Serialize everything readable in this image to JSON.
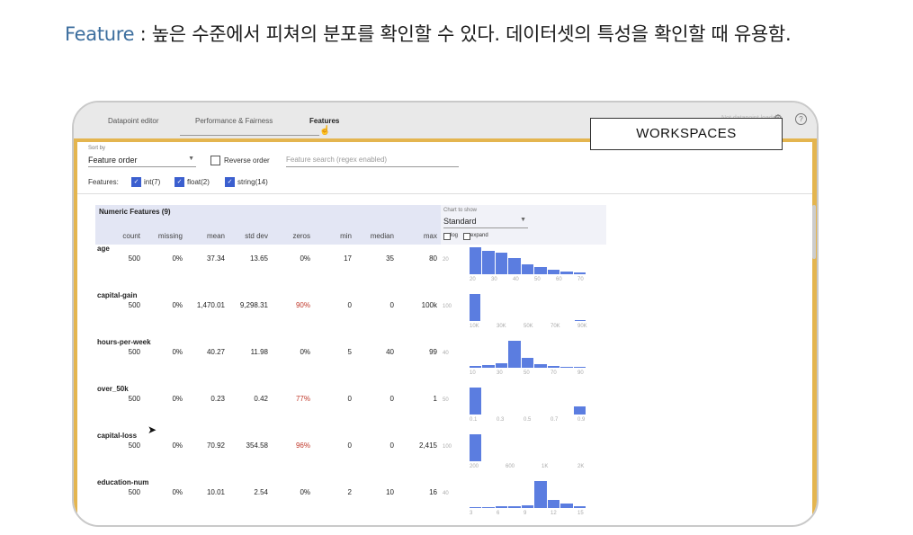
{
  "heading": {
    "keyword": "Feature",
    "text": " : 높은 수준에서 피쳐의 분포를 확인할 수 있다. 데이터셋의 특성을 확인할 때 유용함."
  },
  "header": {
    "tabs": [
      "Datapoint editor",
      "Performance & Fairness",
      "Features"
    ],
    "active_tab": "Features",
    "right_text": "Not datapoint loaded",
    "workspaces_label": "WORKSPACES"
  },
  "controls": {
    "sort_by_label": "Sort by",
    "sort_by_value": "Feature order",
    "reverse_order_label": "Reverse order",
    "search_placeholder": "Feature search (regex enabled)",
    "features_label": "Features:",
    "feature_filters": [
      {
        "label": "int(7)",
        "checked": true
      },
      {
        "label": "float(2)",
        "checked": true
      },
      {
        "label": "string(14)",
        "checked": true
      }
    ]
  },
  "table": {
    "title": "Numeric Features (9)",
    "columns": [
      "count",
      "missing",
      "mean",
      "std dev",
      "zeros",
      "min",
      "median",
      "max"
    ],
    "chart_to_show_label": "Chart to show",
    "chart_to_show_value": "Standard",
    "log_label": "log",
    "expand_label": "expand",
    "rows": [
      {
        "name": "age",
        "count": "500",
        "missing": "0%",
        "mean": "37.34",
        "std": "13.65",
        "zeros": "0%",
        "zeros_red": false,
        "min": "17",
        "median": "35",
        "max": "80",
        "axis_label": "20",
        "ticks": [
          "20",
          "30",
          "40",
          "50",
          "60",
          "70"
        ],
        "hist": [
          1.0,
          0.85,
          0.8,
          0.6,
          0.35,
          0.25,
          0.15,
          0.1,
          0.05
        ]
      },
      {
        "name": "capital-gain",
        "count": "500",
        "missing": "0%",
        "mean": "1,470.01",
        "std": "9,298.31",
        "zeros": "90%",
        "zeros_red": true,
        "min": "0",
        "median": "0",
        "max": "100k",
        "axis_label": "100",
        "ticks": [
          "10K",
          "30K",
          "50K",
          "70K",
          "90K"
        ],
        "hist": [
          1.0,
          0,
          0,
          0,
          0,
          0,
          0,
          0,
          0,
          0.02
        ]
      },
      {
        "name": "hours-per-week",
        "count": "500",
        "missing": "0%",
        "mean": "40.27",
        "std": "11.98",
        "zeros": "0%",
        "zeros_red": false,
        "min": "5",
        "median": "40",
        "max": "99",
        "axis_label": "40",
        "ticks": [
          "10",
          "30",
          "50",
          "70",
          "90"
        ],
        "hist": [
          0.05,
          0.1,
          0.15,
          1.0,
          0.35,
          0.12,
          0.05,
          0.02,
          0.02
        ]
      },
      {
        "name": "over_50k",
        "count": "500",
        "missing": "0%",
        "mean": "0.23",
        "std": "0.42",
        "zeros": "77%",
        "zeros_red": true,
        "min": "0",
        "median": "0",
        "max": "1",
        "axis_label": "50",
        "ticks": [
          "0.1",
          "0.3",
          "0.5",
          "0.7",
          "0.9"
        ],
        "hist": [
          1.0,
          0,
          0,
          0,
          0,
          0,
          0,
          0,
          0.3
        ]
      },
      {
        "name": "capital-loss",
        "count": "500",
        "missing": "0%",
        "mean": "70.92",
        "std": "354.58",
        "zeros": "96%",
        "zeros_red": true,
        "min": "0",
        "median": "0",
        "max": "2,415",
        "axis_label": "100",
        "ticks": [
          "200",
          "600",
          "1K",
          "2K"
        ],
        "hist": [
          1.0,
          0,
          0,
          0,
          0,
          0,
          0,
          0,
          0
        ]
      },
      {
        "name": "education-num",
        "count": "500",
        "missing": "0%",
        "mean": "10.01",
        "std": "2.54",
        "zeros": "0%",
        "zeros_red": false,
        "min": "2",
        "median": "10",
        "max": "16",
        "axis_label": "40",
        "ticks": [
          "3",
          "6",
          "9",
          "12",
          "15"
        ],
        "hist": [
          0.03,
          0.03,
          0.05,
          0.08,
          0.1,
          1.0,
          0.3,
          0.15,
          0.05
        ]
      }
    ]
  },
  "colors": {
    "accent": "#3b5fcf",
    "bar": "#5b7de0",
    "frame": "#e4b54f",
    "warn": "#c0392b"
  }
}
